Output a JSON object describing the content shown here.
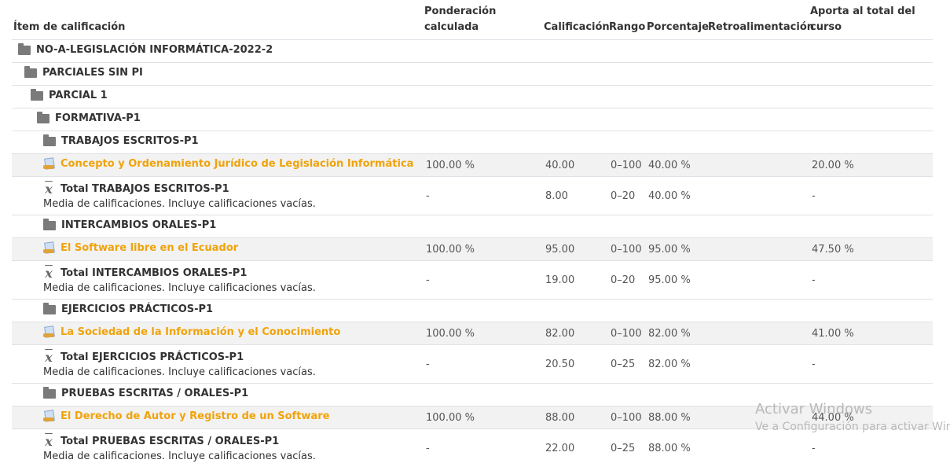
{
  "headers": {
    "item": "Ítem de calificación",
    "weight": "Ponderación calculada",
    "grade": "Calificación",
    "range": "Rango",
    "percentage": "Porcentaje",
    "feedback": "Retroalimentación",
    "contribution": "Aporta al total del curso"
  },
  "course": "NO-A-LEGISLACIÓN INFORMÁTICA-2022-2",
  "category_parciales": "PARCIALES SIN PI",
  "category_parcial1": "PARCIAL 1",
  "category_formativa": "FORMATIVA-P1",
  "total_description": "Media de calificaciones. Incluye calificaciones vacías.",
  "sections": [
    {
      "category": "TRABAJOS ESCRITOS-P1",
      "item": {
        "name": "Concepto y Ordenamiento Jurídico de Legislación Informática",
        "weight": "100.00 %",
        "grade": "40.00",
        "range": "0–100",
        "percentage": "40.00 %",
        "contribution": "20.00 %"
      },
      "total": {
        "name": "Total TRABAJOS ESCRITOS-P1",
        "weight": "-",
        "grade": "8.00",
        "range": "0–20",
        "percentage": "40.00 %",
        "contribution": "-"
      }
    },
    {
      "category": "INTERCAMBIOS ORALES-P1",
      "item": {
        "name": "El Software libre en el Ecuador",
        "weight": "100.00 %",
        "grade": "95.00",
        "range": "0–100",
        "percentage": "95.00 %",
        "contribution": "47.50 %"
      },
      "total": {
        "name": "Total INTERCAMBIOS ORALES-P1",
        "weight": "-",
        "grade": "19.00",
        "range": "0–20",
        "percentage": "95.00 %",
        "contribution": "-"
      }
    },
    {
      "category": "EJERCICIOS PRÁCTICOS-P1",
      "item": {
        "name": "La Sociedad de la Información y el Conocimiento",
        "weight": "100.00 %",
        "grade": "82.00",
        "range": "0–100",
        "percentage": "82.00 %",
        "contribution": "41.00 %"
      },
      "total": {
        "name": "Total EJERCICIOS PRÁCTICOS-P1",
        "weight": "-",
        "grade": "20.50",
        "range": "0–25",
        "percentage": "82.00 %",
        "contribution": "-"
      }
    },
    {
      "category": "PRUEBAS ESCRITAS / ORALES-P1",
      "item": {
        "name": "El Derecho de Autor y Registro de un Software",
        "weight": "100.00 %",
        "grade": "88.00",
        "range": "0–100",
        "percentage": "88.00 %",
        "contribution": "44.00 %"
      },
      "total": {
        "name": "Total PRUEBAS ESCRITAS / ORALES-P1",
        "weight": "-",
        "grade": "22.00",
        "range": "0–25",
        "percentage": "88.00 %",
        "contribution": "-"
      }
    }
  ],
  "watermark": {
    "title": "Activar Windows",
    "subtitle": "Ve a Configuración para activar Windows."
  }
}
